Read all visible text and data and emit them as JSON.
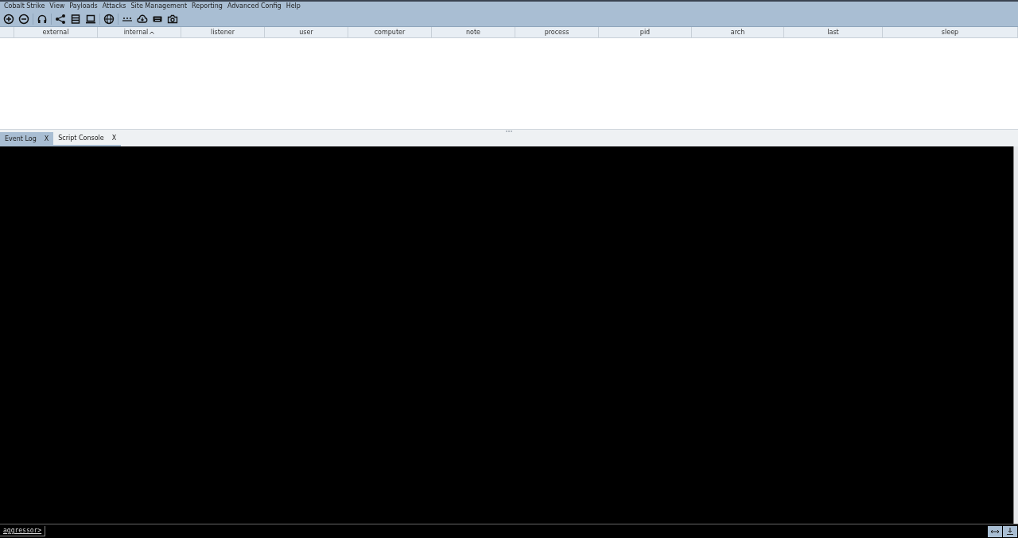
{
  "menu": [
    "Cobalt Strike",
    "View",
    "Payloads",
    "Attacks",
    "Site Management",
    "Reporting",
    "Advanced Config",
    "Help"
  ],
  "toolbar": [
    {
      "kind": "plus-circle"
    },
    {
      "kind": "minus-circle"
    },
    {
      "kind": "separator"
    },
    {
      "kind": "headphones"
    },
    {
      "kind": "separator"
    },
    {
      "kind": "share"
    },
    {
      "kind": "list"
    },
    {
      "kind": "laptop"
    },
    {
      "kind": "separator"
    },
    {
      "kind": "globe"
    },
    {
      "kind": "separator"
    },
    {
      "kind": "dots"
    },
    {
      "kind": "cloud-download"
    },
    {
      "kind": "keyboard"
    },
    {
      "kind": "camera"
    }
  ],
  "table": {
    "columns": [
      {
        "label": "external",
        "sorted": false
      },
      {
        "label": "internal",
        "sorted": true
      },
      {
        "label": "listener",
        "sorted": false
      },
      {
        "label": "user",
        "sorted": false
      },
      {
        "label": "computer",
        "sorted": false
      },
      {
        "label": "note",
        "sorted": false
      },
      {
        "label": "process",
        "sorted": false
      },
      {
        "label": "pid",
        "sorted": false
      },
      {
        "label": "arch",
        "sorted": false
      },
      {
        "label": "last",
        "sorted": false
      },
      {
        "label": "sleep",
        "sorted": false
      }
    ]
  },
  "tabs": [
    {
      "label": "Event Log",
      "close": "X",
      "selected": false
    },
    {
      "label": "Script Console",
      "close": "X",
      "selected": true
    }
  ],
  "console": {
    "prompt": "aggressor>"
  }
}
